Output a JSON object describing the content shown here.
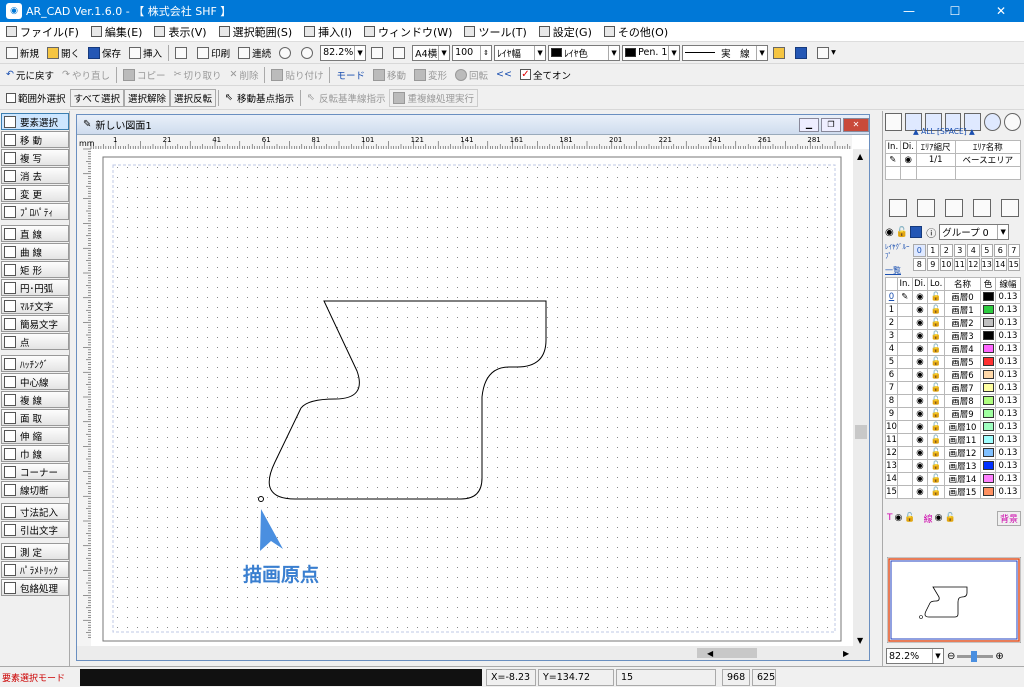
{
  "app": {
    "title": "AR_CAD Ver.1.6.0 - 【 株式会社 SHF 】",
    "icon": "cad-app-icon"
  },
  "window_buttons": {
    "minimize": "—",
    "maximize": "☐",
    "close": "✕"
  },
  "menu": [
    "ファイル(F)",
    "編集(E)",
    "表示(V)",
    "選択範囲(S)",
    "挿入(I)",
    "ウィンドウ(W)",
    "ツール(T)",
    "設定(G)",
    "その他(O)"
  ],
  "toolbar1": {
    "new": "新規",
    "open": "開く",
    "save": "保存",
    "insert": "挿入",
    "print": "印刷",
    "continuous": "連続",
    "zoom": "82.2%",
    "paper": "A4横",
    "scale": "100",
    "layer_width": "ﾚｲﾔ幅",
    "layer_color": "ﾚｲﾔ色",
    "pen": "Pen. 1",
    "linetype": "実　線"
  },
  "toolbar2": {
    "undo": "元に戻す",
    "redo": "やり直し",
    "copy": "コピー",
    "cut": "切り取り",
    "delete": "削除",
    "paste": "貼り付け",
    "mode": "モード",
    "move": "移動",
    "transform": "変形",
    "rotate": "回転",
    "all_on": "全てオン"
  },
  "toolbar3": {
    "outside": "範囲外選択",
    "select_all": "すべて選択",
    "deselect": "選択解除",
    "invert": "選択反転",
    "base_point": "移動基点指示",
    "mirror_base": "反転基準線指示",
    "overlap": "重複線処理実行"
  },
  "left_tools": [
    "要素選択",
    "移 動",
    "複 写",
    "消 去",
    "変 更",
    "ﾌﾟﾛﾊﾟﾃｨ",
    "直 線",
    "曲 線",
    "矩 形",
    "円･円弧",
    "ﾏﾙﾁ文字",
    "簡易文字",
    "点",
    "ﾊｯﾁﾝｸﾞ",
    "中心線",
    "複 線",
    "面 取",
    "伸 縮",
    "巾 線",
    "コーナー",
    "線切断",
    "寸法記入",
    "引出文字",
    "測 定",
    "ﾊﾟﾗﾒﾄﾘｯｸ",
    "包絡処理"
  ],
  "drawing": {
    "title": "新しい図面1",
    "unit": "mm",
    "ruler_h": [
      "1",
      "21",
      "41",
      "61",
      "81",
      "101",
      "121",
      "141",
      "161",
      "181",
      "201",
      "221",
      "241",
      "261",
      "281"
    ],
    "annotation": "描画原点"
  },
  "area_panel": {
    "tabs_label": "▲ ALL [SPACE] ▲",
    "headers": [
      "In.",
      "Di.",
      "ｴﾘｱ縮尺",
      "ｴﾘｱ名称"
    ],
    "rows": [
      {
        "scale": "1/1",
        "name": "ベースエリア"
      }
    ]
  },
  "layer_panel": {
    "group": "グループ 0",
    "group_label": "ﾚｲﾔｸﾞﾙｰﾌﾟ",
    "list_label": "一覧",
    "group_nums_top": [
      "0",
      "1",
      "2",
      "3",
      "4",
      "5",
      "6",
      "7"
    ],
    "group_nums_bottom": [
      "8",
      "9",
      "10",
      "11",
      "12",
      "13",
      "14",
      "15"
    ],
    "headers": [
      "In.",
      "Di.",
      "Lo.",
      "名称",
      "色",
      "線幅"
    ],
    "layers": [
      {
        "num": "0",
        "name": "画層0",
        "color": "#000000",
        "width": "0.13"
      },
      {
        "num": "1",
        "name": "画層1",
        "color": "#2ecc40",
        "width": "0.13"
      },
      {
        "num": "2",
        "name": "画層2",
        "color": "#c0c0c0",
        "width": "0.13"
      },
      {
        "num": "3",
        "name": "画層3",
        "color": "#000000",
        "width": "0.13"
      },
      {
        "num": "4",
        "name": "画層4",
        "color": "#ff66ff",
        "width": "0.13"
      },
      {
        "num": "5",
        "name": "画層5",
        "color": "#ff3030",
        "width": "0.13"
      },
      {
        "num": "6",
        "name": "画層6",
        "color": "#ffd8a8",
        "width": "0.13"
      },
      {
        "num": "7",
        "name": "画層7",
        "color": "#ffffa0",
        "width": "0.13"
      },
      {
        "num": "8",
        "name": "画層8",
        "color": "#b0ff80",
        "width": "0.13"
      },
      {
        "num": "9",
        "name": "画層9",
        "color": "#a0ffa0",
        "width": "0.13"
      },
      {
        "num": "10",
        "name": "画層10",
        "color": "#a0ffc0",
        "width": "0.13"
      },
      {
        "num": "11",
        "name": "画層11",
        "color": "#a0ffff",
        "width": "0.13"
      },
      {
        "num": "12",
        "name": "画層12",
        "color": "#80c0ff",
        "width": "0.13"
      },
      {
        "num": "13",
        "name": "画層13",
        "color": "#0030ff",
        "width": "0.13"
      },
      {
        "num": "14",
        "name": "画層14",
        "color": "#ff80ff",
        "width": "0.13"
      },
      {
        "num": "15",
        "name": "画層15",
        "color": "#ff9060",
        "width": "0.13"
      }
    ],
    "bottom_labels": {
      "T": "T",
      "line": "線",
      "bg": "背景"
    }
  },
  "preview": {
    "zoom": "82.2%"
  },
  "status": {
    "mode": "要素選択モード",
    "x": "X=-8.23",
    "y": "Y=134.72",
    "layer": "15",
    "w": "968",
    "h": "625"
  }
}
